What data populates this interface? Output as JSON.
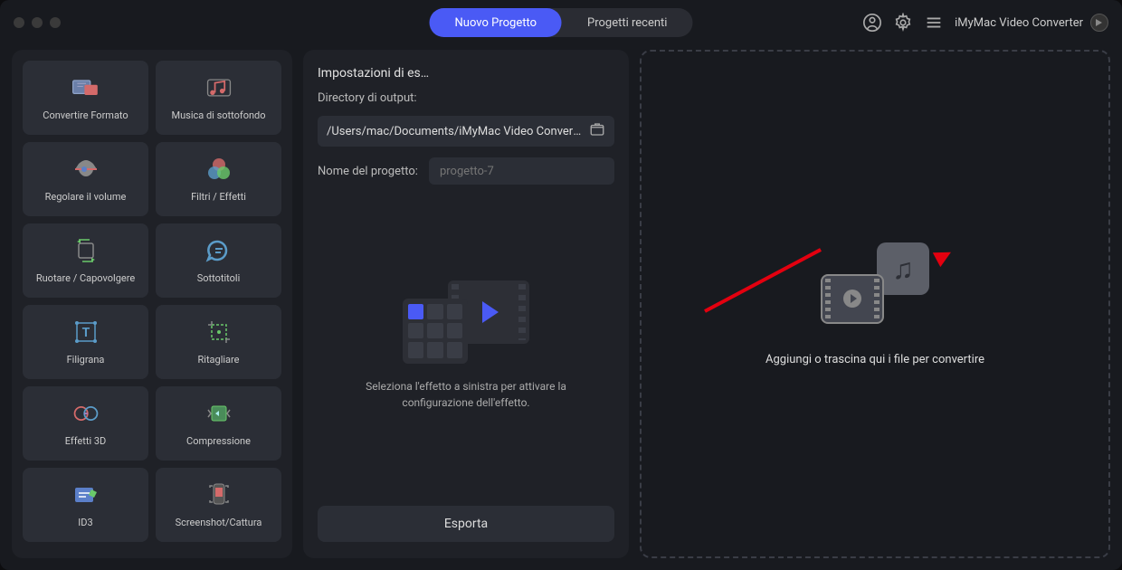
{
  "app_name": "iMyMac Video Converter",
  "tabs": {
    "new_project": "Nuovo Progetto",
    "recent_projects": "Progetti recenti"
  },
  "tools": [
    {
      "id": "convert-format",
      "label": "Convertire Formato"
    },
    {
      "id": "background-music",
      "label": "Musica di sottofondo"
    },
    {
      "id": "adjust-volume",
      "label": "Regolare il volume"
    },
    {
      "id": "filters-effects",
      "label": "Filtri / Effetti"
    },
    {
      "id": "rotate-flip",
      "label": "Ruotare / Capovolgere"
    },
    {
      "id": "subtitles",
      "label": "Sottotitoli"
    },
    {
      "id": "watermark",
      "label": "Filigrana"
    },
    {
      "id": "crop",
      "label": "Ritagliare"
    },
    {
      "id": "3d-effects",
      "label": "Effetti 3D"
    },
    {
      "id": "compression",
      "label": "Compressione"
    },
    {
      "id": "id3",
      "label": "ID3"
    },
    {
      "id": "screenshot-capture",
      "label": "Screenshot/Cattura"
    }
  ],
  "settings": {
    "title": "Impostazioni di es…",
    "output_dir_label": "Directory di output:",
    "output_dir_value": "/Users/mac/Documents/iMyMac Video Converter",
    "project_name_label": "Nome del progetto:",
    "project_name_placeholder": "progetto-7"
  },
  "placeholder_text": "Seleziona l'effetto a sinistra per attivare la configurazione dell'effetto.",
  "export_label": "Esporta",
  "drop_text": "Aggiungi o trascina qui i file per convertire"
}
